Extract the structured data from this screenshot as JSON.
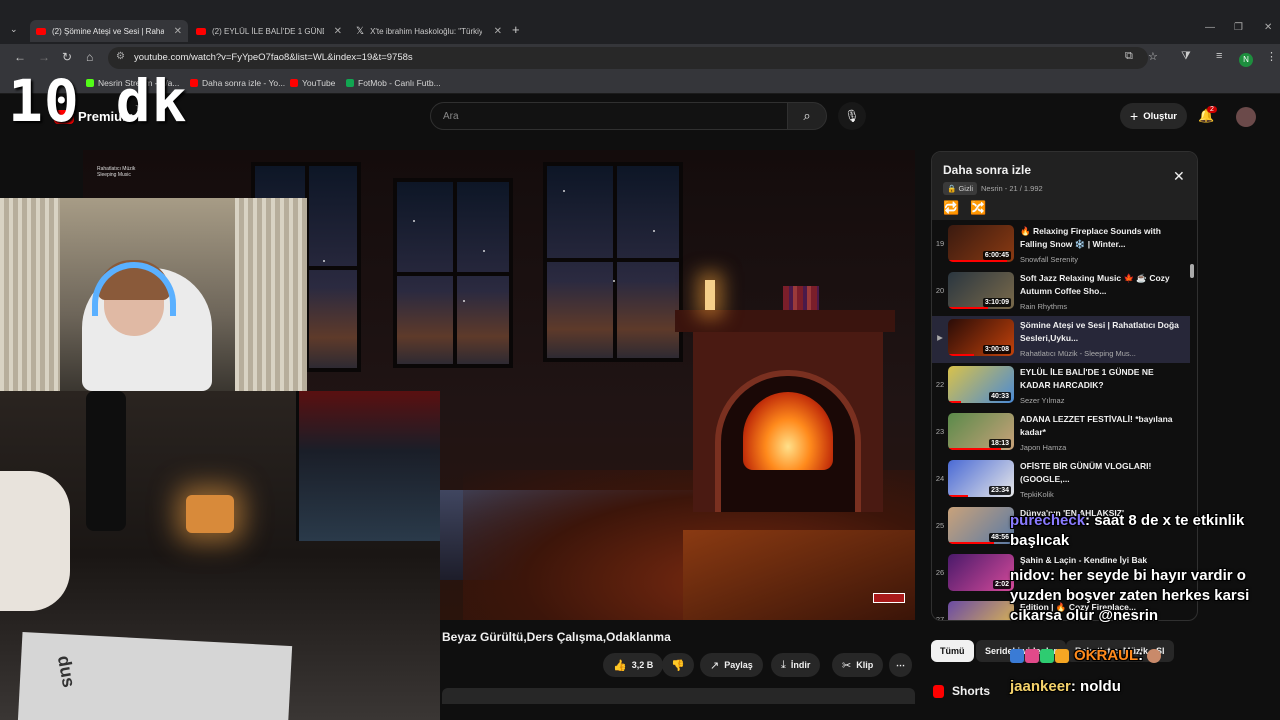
{
  "browser": {
    "tabs": [
      {
        "title": "(2) Şömine Ateşi ve Sesi | Rahatl",
        "active": true
      },
      {
        "title": "(2) EYLÜL İLE BALİ'DE 1 GÜNDE",
        "active": false
      },
      {
        "title": "X'te ibrahim Haskoloğlu: \"Türkiy",
        "active": false
      }
    ],
    "url": "youtube.com/watch?v=FyYpeO7fao8&list=WL&index=19&t=9758s",
    "profile_initial": "N",
    "bookmarks": [
      "Nesrin Stream - Wa...",
      "Daha sonra izle - Yo...",
      "YouTube",
      "FotMob - Canlı Futb..."
    ]
  },
  "youtube": {
    "logo_text": "Premium",
    "logo_region": "TR",
    "search_placeholder": "Ara",
    "create_label": "Oluştur",
    "notification_count": "2"
  },
  "video": {
    "title": "Beyaz Gürültü,Ders Çalışma,Odaklanma",
    "channel_watermark": "Rahatlatıcı Müzik Sleeping Music",
    "likes": "3,2 B",
    "share_label": "Paylaş",
    "download_label": "İndir",
    "clip_label": "Klip"
  },
  "playlist": {
    "title": "Daha sonra izle",
    "privacy": "Gizli",
    "owner_progress": "Nesrin - 21 / 1.992",
    "items": [
      {
        "index": "19",
        "title": "🔥 Relaxing Fireplace Sounds with Falling Snow ❄️ | Winter...",
        "channel": "Snowfall Serenity",
        "duration": "6:00:45",
        "current": false
      },
      {
        "index": "20",
        "title": "Soft Jazz Relaxing Music 🍁 ☕ Cozy Autumn Coffee Sho...",
        "channel": "Rain Rhythms",
        "duration": "3:10:09",
        "current": false
      },
      {
        "index": "▶",
        "title": "Şömine Ateşi ve Sesi | Rahatlatıcı Doğa Sesleri,Uyku...",
        "channel": "Rahatlatıcı Müzik - Sleeping Mus...",
        "duration": "3:00:08",
        "current": true
      },
      {
        "index": "22",
        "title": "EYLÜL İLE BALİ'DE 1 GÜNDE NE KADAR HARCADIK?",
        "channel": "Sezer Yılmaz",
        "duration": "40:33",
        "current": false
      },
      {
        "index": "23",
        "title": "ADANA LEZZET FESTİVALİ! *bayılana kadar*",
        "channel": "Japon Hamza",
        "duration": "18:13",
        "current": false
      },
      {
        "index": "24",
        "title": "OFİSTE BİR GÜNÜM VLOGLARI! (GOOGLE,...",
        "channel": "TepkiKolik",
        "duration": "23:34",
        "current": false
      },
      {
        "index": "25",
        "title": "Dünya'nın 'EN AHLAKSIZ'",
        "channel": "Mert Öztürk",
        "duration": "48:56",
        "current": false
      },
      {
        "index": "26",
        "title": "Şahin & Laçin - Kendine İyi Bak",
        "channel": "",
        "duration": "2:02",
        "current": false
      },
      {
        "index": "27",
        "title": "Edition | 🔥 Cozy Fireplace...",
        "channel": "",
        "duration": "",
        "current": false
      }
    ]
  },
  "chips": {
    "all": "Tümü",
    "series": "Serideki videolar",
    "channel": "Rahatlatıcı Müzik - Sl"
  },
  "shorts_label": "Shorts",
  "overlay": {
    "timer": "10 dk",
    "chat": [
      {
        "user": "purecheck",
        "message": ": saat 8 de x te etkinlik başlıcak",
        "user_color": "#8a7bff"
      },
      {
        "user": "nidov",
        "message": ": her seyde bi hayır vardir o yuzden boşver zaten herkes karsi cikarsa olur @nesrin",
        "user_color": "#ffffff"
      },
      {
        "user": "OKRAUL",
        "message": ":",
        "user_color": "#ff8a1c"
      },
      {
        "user": "jaankeer",
        "message": ": noldu",
        "user_color": "#f3d16a"
      }
    ],
    "desk_text": "dus"
  }
}
